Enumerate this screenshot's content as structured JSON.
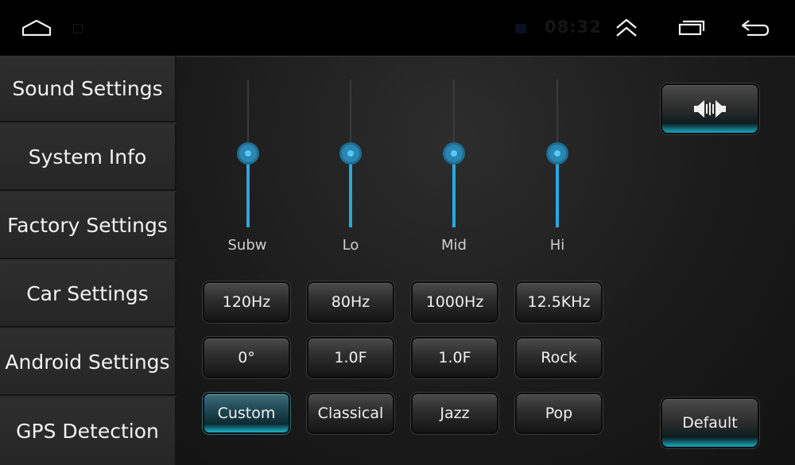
{
  "status_bar": {
    "time": "08:32"
  },
  "sidebar": {
    "items": [
      {
        "label": "Sound Settings"
      },
      {
        "label": "System Info"
      },
      {
        "label": "Factory Settings"
      },
      {
        "label": "Car Settings"
      },
      {
        "label": "Android Settings"
      },
      {
        "label": "GPS Detection"
      }
    ]
  },
  "equalizer": {
    "bands": [
      {
        "label": "Subw",
        "frequency": "120Hz",
        "q": "0°"
      },
      {
        "label": "Lo",
        "frequency": "80Hz",
        "q": "1.0F"
      },
      {
        "label": "Mid",
        "frequency": "1000Hz",
        "q": "1.0F"
      },
      {
        "label": "Hi",
        "frequency": "12.5KHz"
      }
    ],
    "slider_levels": [
      0.5,
      0.5,
      0.5,
      0.5
    ],
    "presets": [
      "Rock",
      "Custom",
      "Classical",
      "Jazz",
      "Pop"
    ],
    "active_preset": "Custom",
    "default_label": "Default",
    "accent_color": "#2aa8dd"
  },
  "icons": {
    "home": "home-icon",
    "up": "double-chevron-up-icon",
    "recents": "recent-apps-icon",
    "back": "back-icon",
    "balance": "speaker-balance-icon"
  }
}
